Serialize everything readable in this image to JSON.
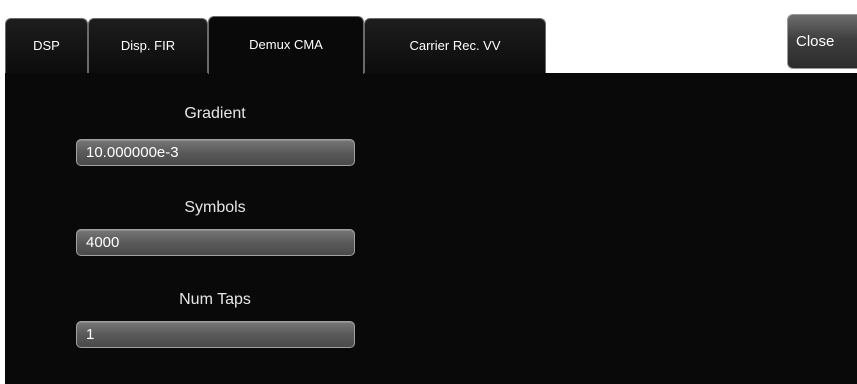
{
  "tabs": [
    {
      "label": "DSP",
      "active": false
    },
    {
      "label": "Disp. FIR",
      "active": false
    },
    {
      "label": "Demux CMA",
      "active": true
    },
    {
      "label": "Carrier Rec. VV",
      "active": false
    }
  ],
  "close_button": {
    "label": "Close"
  },
  "fields": {
    "gradient": {
      "label": "Gradient",
      "value": "10.000000e-3"
    },
    "symbols": {
      "label": "Symbols",
      "value": "4000"
    },
    "num_taps": {
      "label": "Num Taps",
      "value": "1"
    }
  },
  "colors": {
    "panel_background": "#090909",
    "input_background": "#5a5a5a",
    "text": "#ffffff"
  }
}
